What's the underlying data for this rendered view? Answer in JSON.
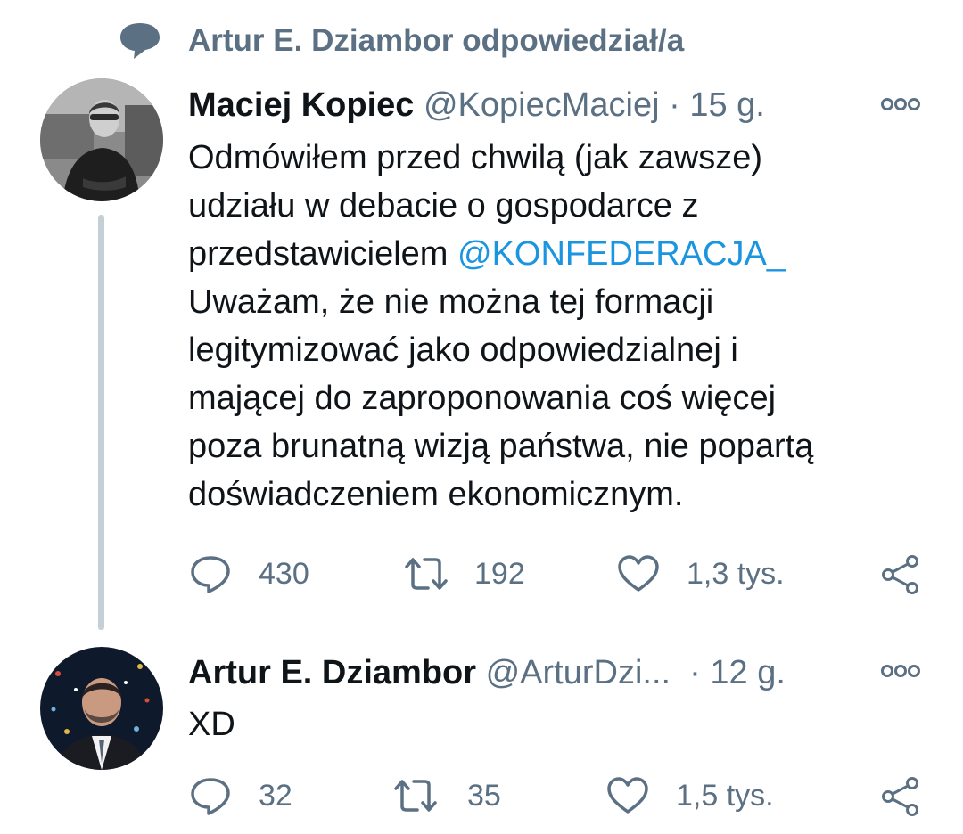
{
  "reply_context": {
    "text": "Artur E. Dziambor odpowiedział/a",
    "icon": "speech-bubble-icon"
  },
  "tweets": [
    {
      "author": "Maciej Kopiec",
      "handle": "@KopiecMaciej",
      "separator": "·",
      "time": "15 g.",
      "text_lines": [
        "Odmówiłem przed chwilą (jak zawsze)",
        "udziału w debacie o gospodarce z",
        "przedstawicielem "
      ],
      "mention": "@KONFEDERACJA_",
      "text_lines_after": [
        "Uważam, że nie można tej formacji",
        "legitymizować jako odpowiedzialnej i",
        "mającej do zaproponowania coś więcej",
        "poza brunatną wizją państwa, nie popartą",
        "doświadczeniem ekonomicznym."
      ],
      "actions": {
        "replies": "430",
        "retweets": "192",
        "likes": "1,3 tys."
      }
    },
    {
      "author": "Artur E. Dziambor",
      "handle": "@ArturDzi...",
      "separator": "·",
      "time": "12 g.",
      "text": "XD",
      "actions": {
        "replies": "32",
        "retweets": "35",
        "likes": "1,5 tys."
      }
    }
  ],
  "colors": {
    "text": "#0f1419",
    "secondary": "#5b7083",
    "link": "#1b95e0",
    "thread_line": "#c4cfd6"
  }
}
